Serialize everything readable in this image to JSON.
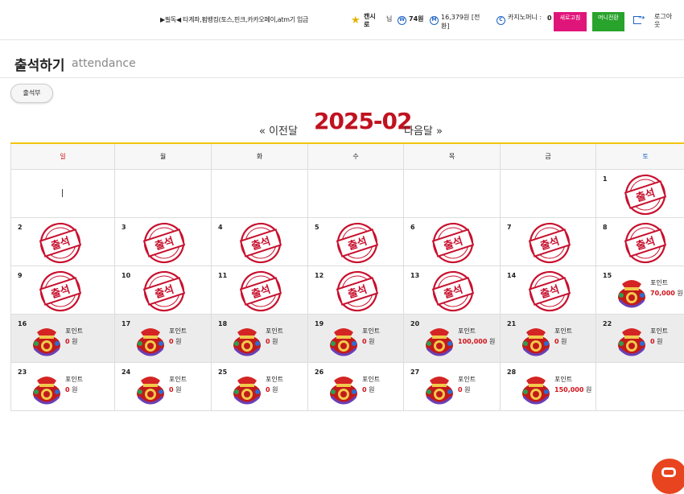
{
  "header": {
    "notice": "▶필독◀ 타계좌,펌뱅킹(토스,핀크,카카오페이,atm기 입금",
    "user_name": "캔시로",
    "user_suffix": "님",
    "coin_value": "74원",
    "money_value": "16,379원 [전환]",
    "casino_label": "카지노머니 :",
    "casino_value": "0",
    "refresh_button": "새로고침",
    "money_transfer_button": "머니전환",
    "logout": "로그아웃",
    "colors": {
      "pink": "#e0157a",
      "green": "#28a32b",
      "blue": "#1e63c4"
    }
  },
  "page": {
    "title": "출석하기",
    "subtitle": "attendance",
    "tab_label": "출석부"
  },
  "calendar": {
    "prev_label": "« 이전달",
    "month": "2025-02",
    "next_label": "다음달 »",
    "weekdays": [
      "일",
      "월",
      "화",
      "수",
      "목",
      "금",
      "토"
    ],
    "weekday_colors": {
      "sun": "#d0121a",
      "sat": "#1e63c4"
    },
    "stamp_text": "출석",
    "point_label": "포인트",
    "won_suffix": "원",
    "days": [
      {
        "day": "1",
        "type": "stamp"
      },
      {
        "day": "2",
        "type": "stamp"
      },
      {
        "day": "3",
        "type": "stamp"
      },
      {
        "day": "4",
        "type": "stamp"
      },
      {
        "day": "5",
        "type": "stamp"
      },
      {
        "day": "6",
        "type": "stamp"
      },
      {
        "day": "7",
        "type": "stamp"
      },
      {
        "day": "8",
        "type": "stamp"
      },
      {
        "day": "9",
        "type": "stamp"
      },
      {
        "day": "10",
        "type": "stamp"
      },
      {
        "day": "11",
        "type": "stamp"
      },
      {
        "day": "12",
        "type": "stamp"
      },
      {
        "day": "13",
        "type": "stamp"
      },
      {
        "day": "14",
        "type": "stamp"
      },
      {
        "day": "15",
        "type": "bag",
        "points": "70,000"
      },
      {
        "day": "16",
        "type": "bag",
        "points": "0"
      },
      {
        "day": "17",
        "type": "bag",
        "points": "0"
      },
      {
        "day": "18",
        "type": "bag",
        "points": "0"
      },
      {
        "day": "19",
        "type": "bag",
        "points": "0"
      },
      {
        "day": "20",
        "type": "bag",
        "points": "100,000"
      },
      {
        "day": "21",
        "type": "bag",
        "points": "0"
      },
      {
        "day": "22",
        "type": "bag",
        "points": "0"
      },
      {
        "day": "23",
        "type": "bag",
        "points": "0"
      },
      {
        "day": "24",
        "type": "bag",
        "points": "0"
      },
      {
        "day": "25",
        "type": "bag",
        "points": "0"
      },
      {
        "day": "26",
        "type": "bag",
        "points": "0"
      },
      {
        "day": "27",
        "type": "bag",
        "points": "0"
      },
      {
        "day": "28",
        "type": "bag",
        "points": "150,000"
      }
    ]
  }
}
